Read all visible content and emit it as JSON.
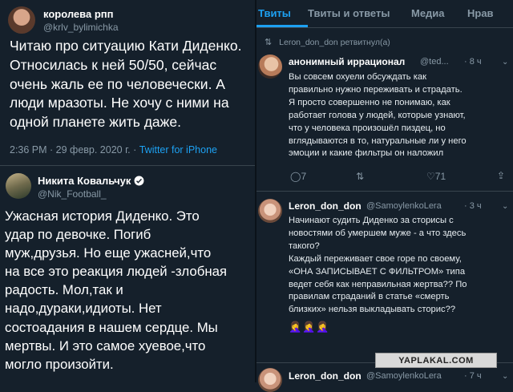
{
  "left": {
    "tweet1": {
      "name": "королева рпп",
      "handle": "@krlv_bylimichka",
      "text": "Читаю про ситуацию Кати Диденко.\nОтносилась к ней 50/50, сейчас\nочень жаль ее по человечески. А\nлюди мразоты. Не хочу с ними на\nодной планете жить даже.",
      "time": "2:36 PM · 29 февр. 2020 г. ·",
      "source": "Twitter for iPhone"
    },
    "tweet2": {
      "name": "Никита Ковальчук",
      "verified_icon": "verified-badge",
      "handle": "@Nik_Football_",
      "text": "Ужасная история Диденко. Это\nудар по девочке. Погиб\nмуж,друзья. Но еще ужасней,что\nна все это реакция людей -злобная\nрадость. Мол,так и\nнадо,дураки,идиоты. Нет\nсостоадания в нашем сердце. Мы\nмертвы. И это самое хуевое,что\nмогло произойти."
    }
  },
  "right": {
    "tabs": [
      "Твиты",
      "Твиты и ответы",
      "Медиа",
      "Нрав"
    ],
    "active_tab": "Твиты",
    "retweet_label": "Leron_don_don ретвитнул(а)",
    "tweet1": {
      "name": "анонимный иррационал",
      "handle": "@ted...",
      "time": "· 8 ч",
      "text": "Вы совсем охуели обсуждать как\nправильно нужно переживать и страдать.\nЯ просто совершенно не понимаю, как\nработает голова у людей, которые узнают,\nчто у человека произошёл пиздец, но\nвглядываются в то, натуральные ли у него\nэмоции и какие фильтры он наложил",
      "replies": "7",
      "likes": "71"
    },
    "tweet2": {
      "name": "Leron_don_don",
      "handle": "@SamoylenkoLera",
      "time": "· 3 ч",
      "text": "Начинают судить Диденко за сторисы с\nновостями об умершем муже - а что здесь\nтакого?\nКаждый переживает свое горе по своему,\n«ОНА ЗАПИСЫВАЕТ С ФИЛЬТРОМ» типа\nведет себя как неправильная жертва?? По\nправилам страданий в статье «смерть\nблизких» нельзя выкладывать сторис??",
      "emoji": "🤦‍♀️🤦‍♀️🤦‍♀️"
    },
    "tweet3": {
      "name": "Leron_don_don",
      "handle": "@SamoylenkoLera",
      "time": "· 7 ч"
    }
  },
  "watermark": "YAPLAKAL.COM"
}
